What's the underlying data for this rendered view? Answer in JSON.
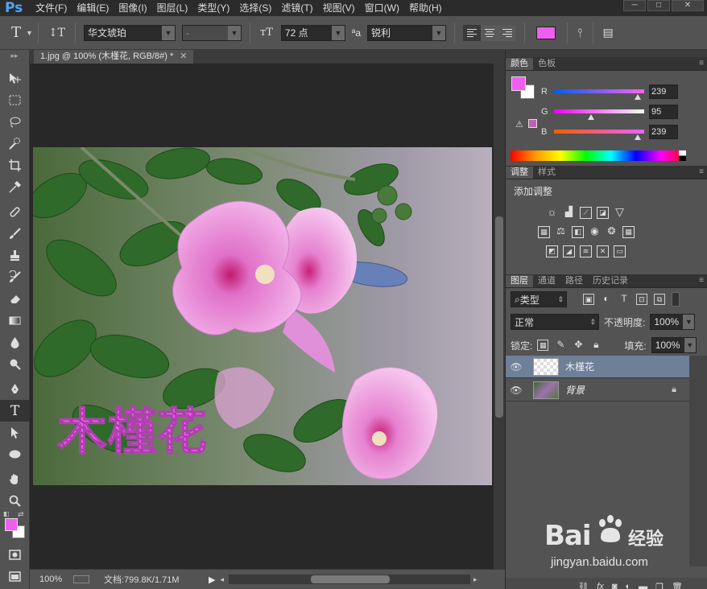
{
  "app": {
    "logo": "Ps"
  },
  "menu": [
    "文件(F)",
    "编辑(E)",
    "图像(I)",
    "图层(L)",
    "类型(Y)",
    "选择(S)",
    "滤镜(T)",
    "视图(V)",
    "窗口(W)",
    "帮助(H)"
  ],
  "options_bar": {
    "tool_icon": "T",
    "font_family": "华文琥珀",
    "font_style": "-",
    "font_size": "72 点",
    "aa_label": "ªa",
    "antialias": "锐利",
    "text_color": "#ef5fef"
  },
  "document": {
    "tab_title": "1.jpg @ 100% (木槿花, RGB/8#) *",
    "canvas_text": "木槿花",
    "text_color": "#e060e0"
  },
  "status": {
    "zoom": "100%",
    "doc_info": "文档:799.8K/1.71M"
  },
  "color_panel": {
    "tabs": [
      "颜色",
      "色板"
    ],
    "r_label": "R",
    "g_label": "G",
    "b_label": "B",
    "r": "239",
    "g": "95",
    "b": "239",
    "fg": "#ef5fef",
    "bg": "#ffffff"
  },
  "adjustments_panel": {
    "tabs": [
      "调整",
      "样式"
    ],
    "title": "添加调整"
  },
  "layers_panel": {
    "tabs": [
      "图层",
      "通道",
      "路径",
      "历史记录"
    ],
    "filter": "类型",
    "blend_mode": "正常",
    "opacity_label": "不透明度:",
    "opacity": "100%",
    "lock_label": "锁定:",
    "fill_label": "填充:",
    "fill": "100%",
    "layers": [
      {
        "name": "木槿花",
        "selected": true
      },
      {
        "name": "背景",
        "locked": true
      }
    ]
  },
  "watermark": {
    "brand": "Bai",
    "brand_cn": "经验",
    "url": "jingyan.baidu.com"
  }
}
